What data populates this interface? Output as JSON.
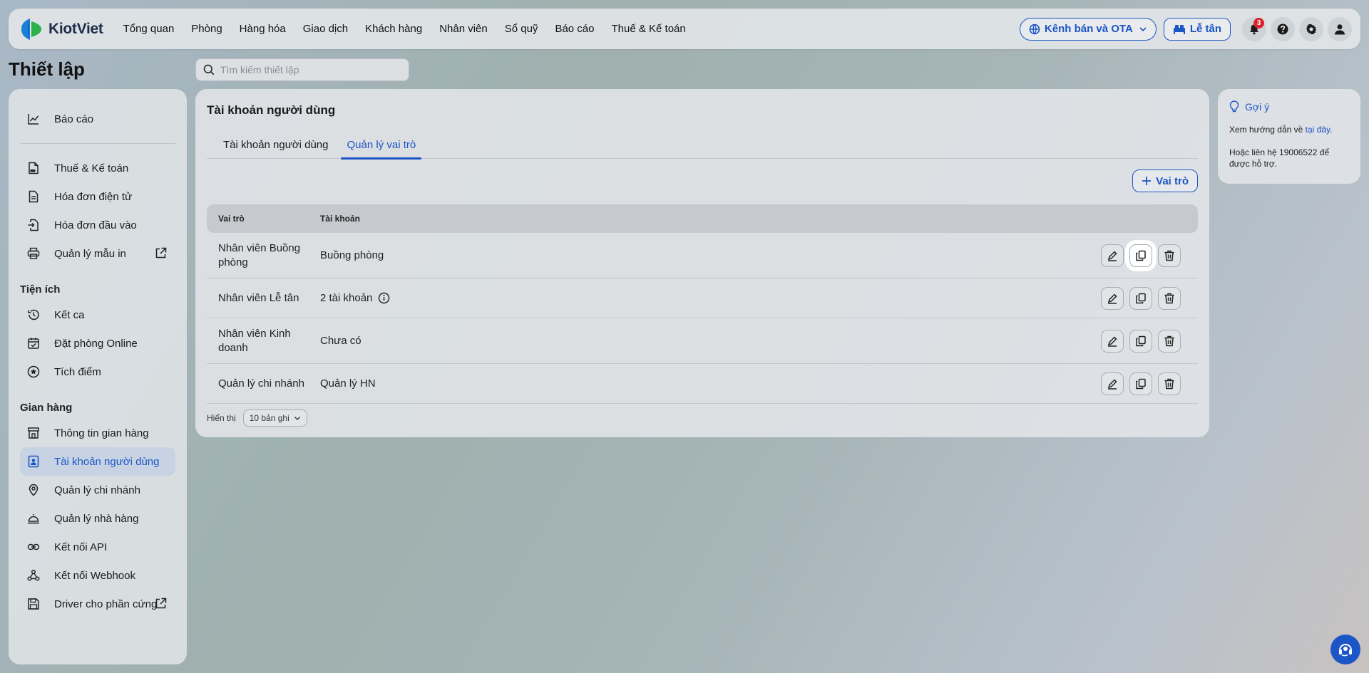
{
  "app": {
    "name": "KiotViet"
  },
  "nav": {
    "items": [
      "Tổng quan",
      "Phòng",
      "Hàng hóa",
      "Giao dịch",
      "Khách hàng",
      "Nhân viên",
      "Sổ quỹ",
      "Báo cáo",
      "Thuế & Kế toán"
    ]
  },
  "topbar": {
    "channel_label": "Kênh bán và OTA",
    "reception_label": "Lễ tân",
    "notification_count": "3"
  },
  "page": {
    "title": "Thiết lập"
  },
  "search": {
    "placeholder": "Tìm kiếm thiết lập"
  },
  "sidebar": {
    "report": "Báo cáo",
    "group1": [
      "Thuế & Kế toán",
      "Hóa đơn điện tử",
      "Hóa đơn đầu vào",
      "Quản lý mẫu in"
    ],
    "utilities_heading": "Tiện ích",
    "utilities": [
      "Kết ca",
      "Đặt phòng Online",
      "Tích điểm"
    ],
    "store_heading": "Gian hàng",
    "store": [
      "Thông tin gian hàng",
      "Tài khoản người dùng",
      "Quản lý chi nhánh",
      "Quản lý nhà hàng",
      "Kết nối API",
      "Kết nối Webhook",
      "Driver cho phần cứng"
    ]
  },
  "main": {
    "title": "Tài khoản người dùng",
    "tabs": [
      "Tài khoản người dùng",
      "Quản lý vai trò"
    ],
    "add_role_label": "Vai trò",
    "table": {
      "headers": [
        "Vai trò",
        "Tài khoản"
      ],
      "rows": [
        {
          "role": "Nhân viên Buồng phòng",
          "account": "Buồng phòng"
        },
        {
          "role": "Nhân viên Lễ tân",
          "account": "2 tài khoản"
        },
        {
          "role": "Nhân viên Kinh doanh",
          "account": "Chưa có"
        },
        {
          "role": "Quản lý chi nhánh",
          "account": "Quản lý HN"
        }
      ]
    },
    "show_label": "Hiển thị",
    "page_size": "10 bản ghi"
  },
  "hint": {
    "title": "Gợi ý",
    "line1_prefix": "Xem hướng dẫn về ",
    "line1_link": "tại đây",
    "line1_suffix": ".",
    "line2": "Hoặc liên hệ 19006522 để được hỗ trợ."
  },
  "colors": {
    "accent": "#1c55c6",
    "badge": "#d9232d"
  }
}
